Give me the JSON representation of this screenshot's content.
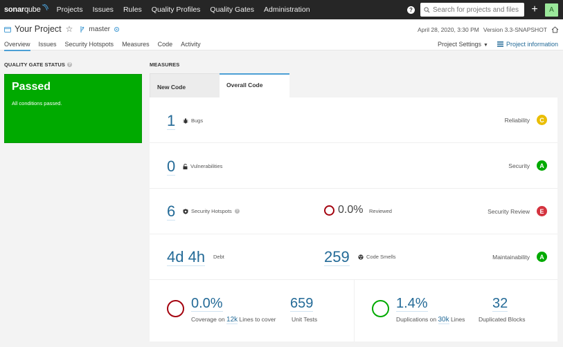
{
  "topnav": {
    "logo_main": "sonar",
    "logo_q": "qube",
    "items": [
      "Projects",
      "Issues",
      "Rules",
      "Quality Profiles",
      "Quality Gates",
      "Administration"
    ],
    "search_placeholder": "Search for projects and files...",
    "help_label": "?",
    "add_label": "+",
    "avatar_letter": "A"
  },
  "project": {
    "name": "Your Project",
    "branch": "master",
    "date": "April 28, 2020, 3:30 PM",
    "version": "Version 3.3-SNAPSHOT",
    "tabs": [
      "Overview",
      "Issues",
      "Security Hotspots",
      "Measures",
      "Code",
      "Activity"
    ],
    "active_tab": "Overview",
    "settings_label": "Project Settings",
    "info_label": "Project information"
  },
  "quality_gate": {
    "title": "QUALITY GATE STATUS",
    "status": "Passed",
    "description": "All conditions passed.",
    "color": "#00aa00"
  },
  "measures": {
    "title": "MEASURES",
    "tabs": [
      "New Code",
      "Overall Code"
    ],
    "active_tab": "Overall Code",
    "bugs": {
      "value": "1",
      "label": "Bugs",
      "rating_label": "Reliability",
      "rating": "C",
      "rating_color": "#eabe06"
    },
    "vulnerabilities": {
      "value": "0",
      "label": "Vulnerabilities",
      "rating_label": "Security",
      "rating": "A",
      "rating_color": "#00aa00"
    },
    "hotspots": {
      "value": "6",
      "label": "Security Hotspots",
      "reviewed_value": "0.0%",
      "reviewed_label": "Reviewed",
      "rating_label": "Security Review",
      "rating": "E",
      "rating_color": "#d4333f"
    },
    "maintainability": {
      "debt_value": "4d 4h",
      "debt_label": "Debt",
      "smells_value": "259",
      "smells_label": "Code Smells",
      "rating_label": "Maintainability",
      "rating": "A",
      "rating_color": "#00aa00"
    },
    "coverage": {
      "value": "0.0%",
      "label_prefix": "Coverage on",
      "lines_value": "12k",
      "label_suffix": "Lines to cover",
      "unit_tests_value": "659",
      "unit_tests_label": "Unit Tests",
      "ring_color": "#a4030f"
    },
    "duplications": {
      "value": "1.4%",
      "label_prefix": "Duplications on",
      "lines_value": "30k",
      "label_suffix": "Lines",
      "blocks_value": "32",
      "blocks_label": "Duplicated Blocks",
      "ring_color": "#00aa00"
    }
  }
}
